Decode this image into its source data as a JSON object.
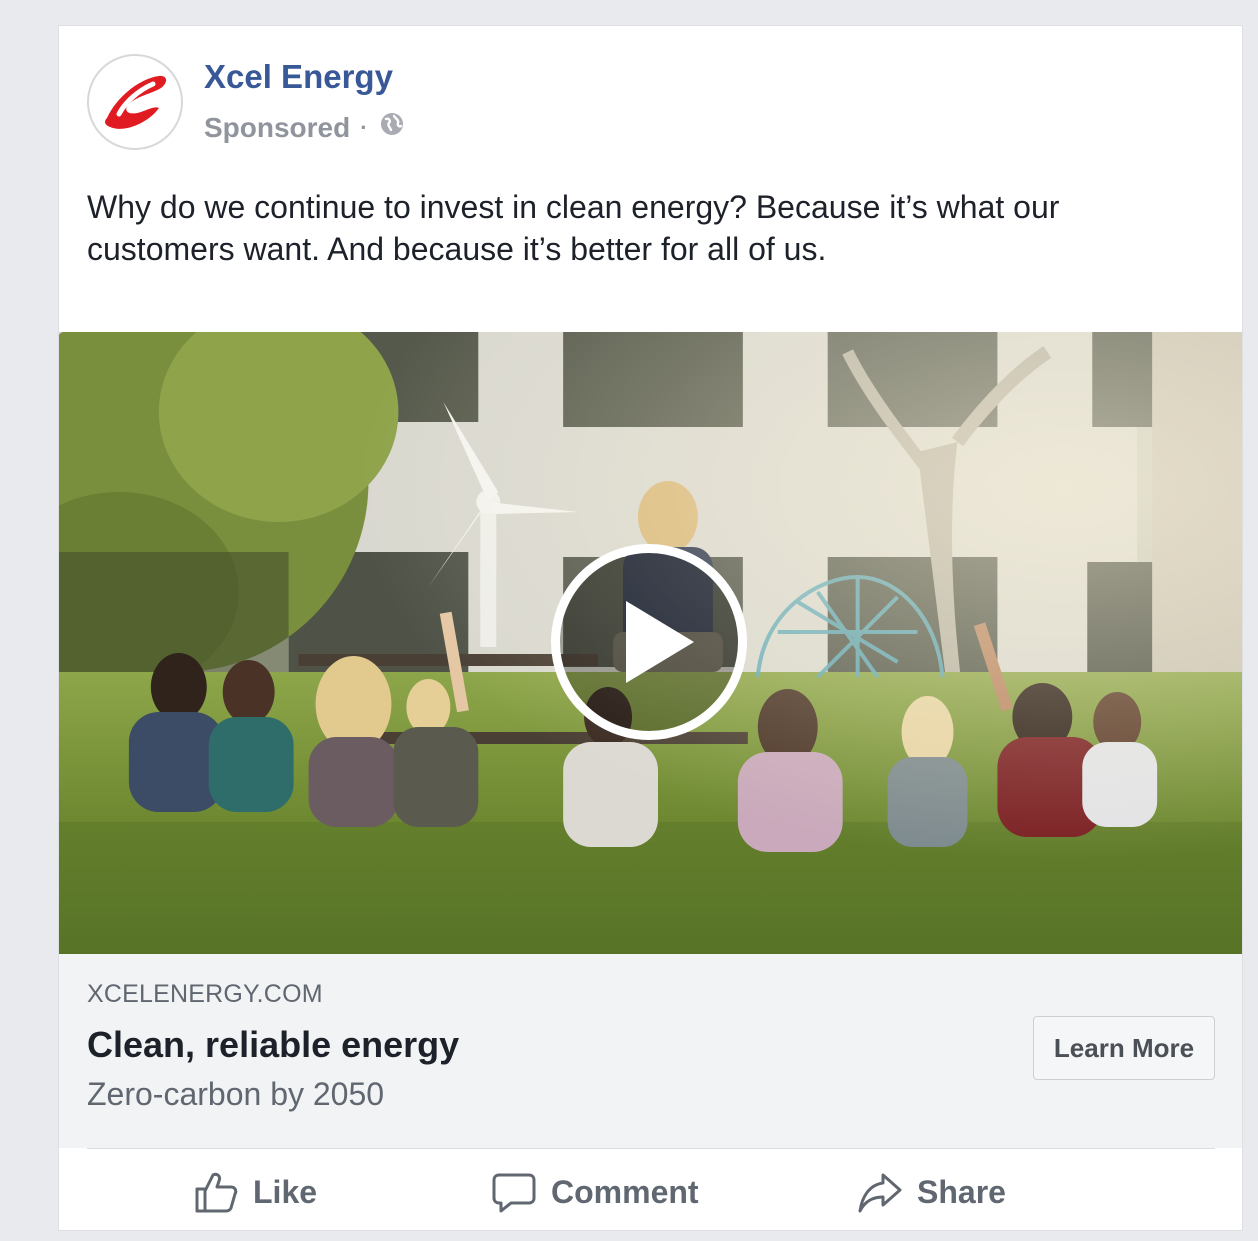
{
  "post": {
    "page_name": "Xcel Energy",
    "sponsored_label": "Sponsored",
    "separator": "·",
    "audience_icon": "globe-icon",
    "brand_color": "#385898",
    "logo_color": "#e01b22",
    "text": "Why do we continue to invest in clean energy? Because it’s what our customers want. And because it’s better for all of us."
  },
  "media": {
    "type": "video",
    "play_icon": "play-icon"
  },
  "link": {
    "domain": "XCELENERGY.COM",
    "title": "Clean, reliable energy",
    "description": "Zero-carbon by 2050",
    "cta_label": "Learn More"
  },
  "actions": {
    "like_label": "Like",
    "like_icon": "thumbs-up-icon",
    "comment_label": "Comment",
    "comment_icon": "comment-bubble-icon",
    "share_label": "Share",
    "share_icon": "share-arrow-icon"
  }
}
